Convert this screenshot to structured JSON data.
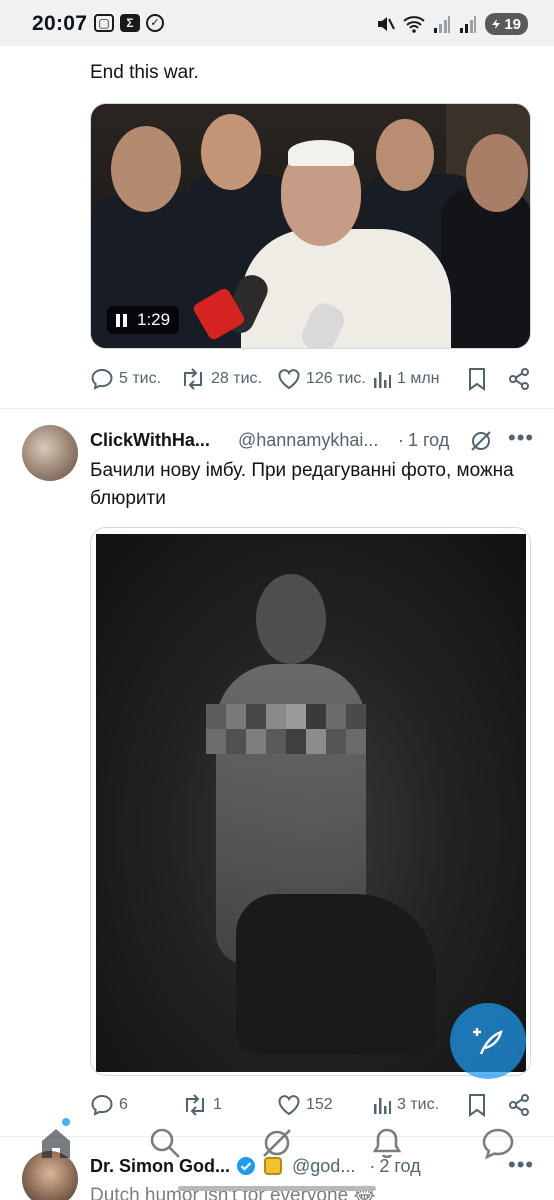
{
  "status_bar": {
    "time": "20:07",
    "left_icons": [
      "screenshot-icon",
      "sigma-icon",
      "check-circle-icon"
    ],
    "right_icons": [
      "mute-icon",
      "wifi-icon",
      "signal-icon",
      "signal-icon"
    ],
    "battery": "19"
  },
  "tweet1": {
    "text": "End this war.",
    "video": {
      "duration": "1:29",
      "state": "playing"
    },
    "stats": {
      "replies": "5 тис.",
      "reposts": "28 тис.",
      "likes": "126 тис.",
      "views": "1 млн"
    }
  },
  "tweet2": {
    "name": "ClickWithHa...",
    "handle": "@hannamykhai...",
    "separator": "·",
    "time": "1 год",
    "text": "Бачили нову імбу. При редагуванні фото, можна блюрити",
    "stats": {
      "replies": "6",
      "reposts": "1",
      "likes": "152",
      "views": "3 тис."
    }
  },
  "tweet3": {
    "name": "Dr. Simon God...",
    "handle": "@god...",
    "separator": "·",
    "time": "2 год",
    "text": "Dutch humor isn't for everyone 😂"
  },
  "fab": {
    "icon": "compose-feather-icon"
  },
  "bottom_nav": [
    "home-icon",
    "search-icon",
    "grok-icon",
    "notifications-icon",
    "messages-icon"
  ],
  "colors": {
    "accent": "#1d9bf0",
    "muted": "#536471",
    "text": "#0f1419"
  }
}
